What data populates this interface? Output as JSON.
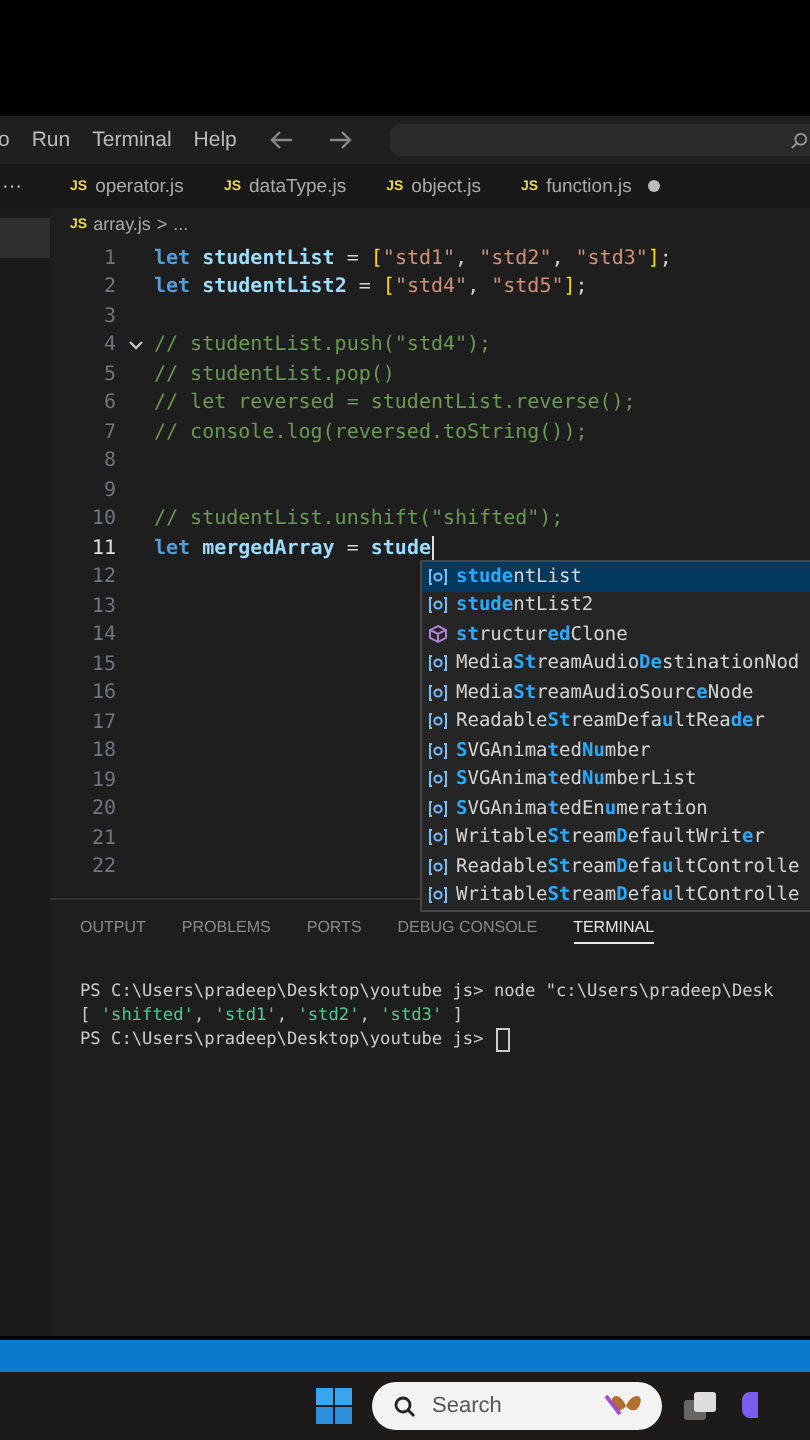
{
  "menu": [
    {
      "label": "o"
    },
    {
      "label": "Run"
    },
    {
      "label": "Terminal"
    },
    {
      "label": "Help"
    }
  ],
  "sidebar_more": "···",
  "tabs": [
    {
      "label": "operator.js",
      "badge": "JS",
      "selected": false,
      "dirty": false
    },
    {
      "label": "dataType.js",
      "badge": "JS",
      "selected": false,
      "dirty": false
    },
    {
      "label": "object.js",
      "badge": "JS",
      "selected": false,
      "dirty": false
    },
    {
      "label": "function.js",
      "badge": "JS",
      "selected": false,
      "dirty": true
    }
  ],
  "breadcrumb": {
    "badge": "JS",
    "file": "array.js",
    "separator": ">",
    "rest": "..."
  },
  "code": [
    {
      "number": "1",
      "current": false,
      "tokens": [
        {
          "kind": "keyword",
          "text": "let "
        },
        {
          "kind": "var",
          "text": "studentList"
        },
        {
          "kind": "op",
          "text": " = "
        },
        {
          "kind": "bracket",
          "text": "["
        },
        {
          "kind": "string",
          "text": "\"std1\""
        },
        {
          "kind": "op",
          "text": ", "
        },
        {
          "kind": "string",
          "text": "\"std2\""
        },
        {
          "kind": "op",
          "text": ", "
        },
        {
          "kind": "string",
          "text": "\"std3\""
        },
        {
          "kind": "bracket",
          "text": "]"
        },
        {
          "kind": "op",
          "text": ";"
        }
      ]
    },
    {
      "number": "2",
      "current": false,
      "tokens": [
        {
          "kind": "keyword",
          "text": "let "
        },
        {
          "kind": "var",
          "text": "studentList2"
        },
        {
          "kind": "op",
          "text": " = "
        },
        {
          "kind": "bracket",
          "text": "["
        },
        {
          "kind": "string",
          "text": "\"std4\""
        },
        {
          "kind": "op",
          "text": ", "
        },
        {
          "kind": "string",
          "text": "\"std5\""
        },
        {
          "kind": "bracket",
          "text": "]"
        },
        {
          "kind": "op",
          "text": ";"
        }
      ]
    },
    {
      "number": "3",
      "current": false
    },
    {
      "number": "4",
      "current": false,
      "foldable": true,
      "tokens": [
        {
          "kind": "comment",
          "text": "// studentList.push(\"std4\");"
        }
      ]
    },
    {
      "number": "5",
      "current": false,
      "tokens": [
        {
          "kind": "comment",
          "text": "// studentList.pop()"
        }
      ]
    },
    {
      "number": "6",
      "current": false,
      "tokens": [
        {
          "kind": "comment",
          "text": "// let reversed = studentList.reverse();"
        }
      ]
    },
    {
      "number": "7",
      "current": false,
      "tokens": [
        {
          "kind": "comment",
          "text": "// console.log(reversed.toString());"
        }
      ]
    },
    {
      "number": "8",
      "current": false
    },
    {
      "number": "9",
      "current": false
    },
    {
      "number": "10",
      "current": false,
      "tokens": [
        {
          "kind": "comment",
          "text": "// studentList.unshift(\"shifted\");"
        }
      ]
    },
    {
      "number": "11",
      "current": true,
      "cursor": true,
      "tokens": [
        {
          "kind": "keyword",
          "text": "let "
        },
        {
          "kind": "var",
          "text": "mergedArray"
        },
        {
          "kind": "op",
          "text": " = "
        },
        {
          "kind": "var",
          "text": "stude"
        }
      ]
    },
    {
      "number": "12",
      "current": false
    },
    {
      "number": "13",
      "current": false
    },
    {
      "number": "14",
      "current": false
    },
    {
      "number": "15",
      "current": false
    },
    {
      "number": "16",
      "current": false
    },
    {
      "number": "17",
      "current": false
    },
    {
      "number": "18",
      "current": false
    },
    {
      "number": "19",
      "current": false
    },
    {
      "number": "20",
      "current": false
    },
    {
      "number": "21",
      "current": false
    },
    {
      "number": "22",
      "current": false
    }
  ],
  "suggestions": [
    {
      "kind": "variable",
      "selected": true,
      "text": "**stude**ntList"
    },
    {
      "kind": "variable",
      "selected": false,
      "text": "**stude**ntList2"
    },
    {
      "kind": "method",
      "selected": false,
      "text": "**st**ructur**ed**Clone"
    },
    {
      "kind": "variable",
      "selected": false,
      "text": "Media**St**reamAudio**De**stinationNod"
    },
    {
      "kind": "variable",
      "selected": false,
      "text": "Media**St**reamAudioSourc**e**Node"
    },
    {
      "kind": "variable",
      "selected": false,
      "text": "Readable**St**reamDefa**u**ltRea**de**r"
    },
    {
      "kind": "variable",
      "selected": false,
      "text": "**S**VGAnima**t**ed**Nu**mber"
    },
    {
      "kind": "variable",
      "selected": false,
      "text": "**S**VGAnima**t**ed**Nu**mberList"
    },
    {
      "kind": "variable",
      "selected": false,
      "text": "**S**VGAnima**t**edEn**u**meration"
    },
    {
      "kind": "variable",
      "selected": false,
      "text": "Writable**St**ream**D**efaultWrit**e**r"
    },
    {
      "kind": "variable",
      "selected": false,
      "text": "Readable**St**ream**D**efa**u**ltControlle"
    },
    {
      "kind": "variable",
      "selected": false,
      "text": "Writable**St**ream**D**efa**u**ltControlle"
    }
  ],
  "panel_tabs": [
    {
      "label": "OUTPUT",
      "selected": false
    },
    {
      "label": "PROBLEMS",
      "selected": false
    },
    {
      "label": "PORTS",
      "selected": false
    },
    {
      "label": "DEBUG CONSOLE",
      "selected": false
    },
    {
      "label": "TERMINAL",
      "selected": true
    }
  ],
  "terminal": [
    {
      "tokens": [
        {
          "kind": "plain",
          "text": "PS C:\\Users\\pradeep\\Desktop\\youtube js> node \"c:\\Users\\pradeep\\Desk"
        }
      ]
    },
    {
      "tokens": [
        {
          "kind": "plain",
          "text": "[ "
        },
        {
          "kind": "string",
          "text": "'shifted'"
        },
        {
          "kind": "plain",
          "text": ", "
        },
        {
          "kind": "string",
          "text": "'std1'"
        },
        {
          "kind": "plain",
          "text": ", "
        },
        {
          "kind": "string",
          "text": "'std2'"
        },
        {
          "kind": "plain",
          "text": ", "
        },
        {
          "kind": "string",
          "text": "'std3'"
        },
        {
          "kind": "plain",
          "text": " ]"
        }
      ]
    },
    {
      "cursor": true,
      "tokens": [
        {
          "kind": "plain",
          "text": "PS C:\\Users\\pradeep\\Desktop\\youtube js>"
        }
      ]
    }
  ],
  "taskbar": {
    "search_label": "Search"
  }
}
